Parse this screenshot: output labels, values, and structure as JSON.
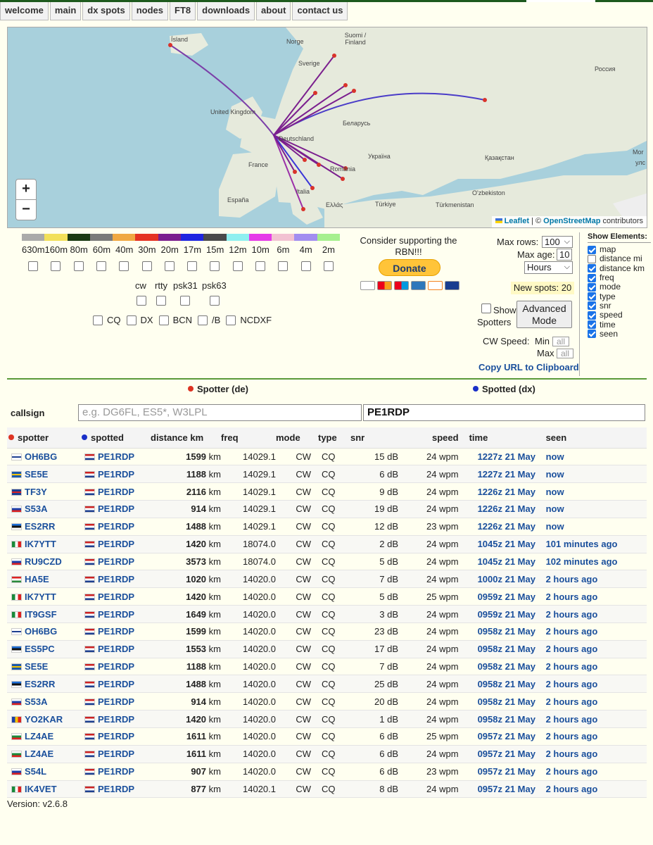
{
  "nav": [
    "welcome",
    "main",
    "dx spots",
    "nodes",
    "FT8",
    "downloads",
    "about",
    "contact us"
  ],
  "map": {
    "labels": [
      "Ísland",
      "Suomi / Finland",
      "Norge",
      "Sverige",
      "Россия",
      "United Kingdom",
      "Беларусь",
      "Deutschland",
      "France",
      "Україна",
      "Қазақстан",
      "România",
      "España",
      "Italia",
      "Ελλάς",
      "Türkiye",
      "O'zbekiston",
      "Türkmenistan",
      "Mor",
      "улс"
    ],
    "zoom_in": "+",
    "zoom_out": "−",
    "attribution_leaflet": "Leaflet",
    "attribution_sep": " | © ",
    "attribution_osm": "OpenStreetMap",
    "attribution_tail": " contributors"
  },
  "bands": {
    "labels": [
      "630m",
      "160m",
      "80m",
      "60m",
      "40m",
      "30m",
      "20m",
      "17m",
      "15m",
      "12m",
      "10m",
      "6m",
      "4m",
      "2m"
    ],
    "colors": [
      "#aaaaaa",
      "#f2e05a",
      "#1b3a12",
      "#7a7a7a",
      "#f0a842",
      "#e53322",
      "#7b1f8e",
      "#1f26e0",
      "#4a4a4a",
      "#8ff0f0",
      "#e63be8",
      "#f2c2d2",
      "#a28ef0",
      "#a6f08e"
    ]
  },
  "modes": [
    "cw",
    "rtty",
    "psk31",
    "psk63"
  ],
  "filters": [
    "CQ",
    "DX",
    "BCN",
    "/B",
    "NCDXF"
  ],
  "donate": {
    "message": "Consider supporting the RBN!!!",
    "button": "Donate"
  },
  "controls": {
    "max_rows_label": "Max rows:",
    "max_rows_value": "100",
    "max_age_label": "Max age:",
    "max_age_value": "10",
    "age_unit": "Hours",
    "new_spots": "New spots: 20",
    "show_label": "Show",
    "spotters_label": "Spotters",
    "advanced_mode": "Advanced Mode",
    "cw_speed_label": "CW Speed:",
    "min_label": "Min",
    "max_label": "Max",
    "all_placeholder": "all",
    "copy_url": "Copy URL to Clipboard"
  },
  "show_elements": {
    "title": "Show Elements:",
    "items": [
      {
        "label": "map",
        "checked": true
      },
      {
        "label": "distance mi",
        "checked": false
      },
      {
        "label": "distance km",
        "checked": true
      },
      {
        "label": "freq",
        "checked": true
      },
      {
        "label": "mode",
        "checked": true
      },
      {
        "label": "type",
        "checked": true
      },
      {
        "label": "snr",
        "checked": true
      },
      {
        "label": "speed",
        "checked": true
      },
      {
        "label": "time",
        "checked": true
      },
      {
        "label": "seen",
        "checked": true
      }
    ]
  },
  "search": {
    "spotter_header": "Spotter (de)",
    "spotted_header": "Spotted (dx)",
    "callsign_label": "callsign",
    "spotter_placeholder": "e.g. DG6FL, ES5*, W3LPL",
    "spotted_value": "PE1RDP"
  },
  "table": {
    "headers": [
      "spotter",
      "spotted",
      "distance km",
      "freq",
      "mode",
      "type",
      "snr",
      "speed",
      "time",
      "seen"
    ],
    "rows": [
      {
        "spotter": "OH6BG",
        "flag": "fi",
        "spotted": "PE1RDP",
        "dist": "1599",
        "unit": "km",
        "freq": "14029.1",
        "mode": "CW",
        "type": "CQ",
        "snr": "15 dB",
        "speed": "24 wpm",
        "time": "1227z 21 May",
        "seen": "now"
      },
      {
        "spotter": "SE5E",
        "flag": "se",
        "spotted": "PE1RDP",
        "dist": "1188",
        "unit": "km",
        "freq": "14029.1",
        "mode": "CW",
        "type": "CQ",
        "snr": "6 dB",
        "speed": "24 wpm",
        "time": "1227z 21 May",
        "seen": "now"
      },
      {
        "spotter": "TF3Y",
        "flag": "is",
        "spotted": "PE1RDP",
        "dist": "2116",
        "unit": "km",
        "freq": "14029.1",
        "mode": "CW",
        "type": "CQ",
        "snr": "9 dB",
        "speed": "24 wpm",
        "time": "1226z 21 May",
        "seen": "now"
      },
      {
        "spotter": "S53A",
        "flag": "si",
        "spotted": "PE1RDP",
        "dist": "914",
        "unit": "km",
        "freq": "14029.1",
        "mode": "CW",
        "type": "CQ",
        "snr": "19 dB",
        "speed": "24 wpm",
        "time": "1226z 21 May",
        "seen": "now"
      },
      {
        "spotter": "ES2RR",
        "flag": "ee",
        "spotted": "PE1RDP",
        "dist": "1488",
        "unit": "km",
        "freq": "14029.1",
        "mode": "CW",
        "type": "CQ",
        "snr": "12 dB",
        "speed": "23 wpm",
        "time": "1226z 21 May",
        "seen": "now"
      },
      {
        "spotter": "IK7YTT",
        "flag": "it",
        "spotted": "PE1RDP",
        "dist": "1420",
        "unit": "km",
        "freq": "18074.0",
        "mode": "CW",
        "type": "CQ",
        "snr": "2 dB",
        "speed": "24 wpm",
        "time": "1045z 21 May",
        "seen": "101 minutes ago"
      },
      {
        "spotter": "RU9CZD",
        "flag": "ru",
        "spotted": "PE1RDP",
        "dist": "3573",
        "unit": "km",
        "freq": "18074.0",
        "mode": "CW",
        "type": "CQ",
        "snr": "5 dB",
        "speed": "24 wpm",
        "time": "1045z 21 May",
        "seen": "102 minutes ago"
      },
      {
        "spotter": "HA5E",
        "flag": "hu",
        "spotted": "PE1RDP",
        "dist": "1020",
        "unit": "km",
        "freq": "14020.0",
        "mode": "CW",
        "type": "CQ",
        "snr": "7 dB",
        "speed": "24 wpm",
        "time": "1000z 21 May",
        "seen": "2 hours ago"
      },
      {
        "spotter": "IK7YTT",
        "flag": "it",
        "spotted": "PE1RDP",
        "dist": "1420",
        "unit": "km",
        "freq": "14020.0",
        "mode": "CW",
        "type": "CQ",
        "snr": "5 dB",
        "speed": "25 wpm",
        "time": "0959z 21 May",
        "seen": "2 hours ago"
      },
      {
        "spotter": "IT9GSF",
        "flag": "it",
        "spotted": "PE1RDP",
        "dist": "1649",
        "unit": "km",
        "freq": "14020.0",
        "mode": "CW",
        "type": "CQ",
        "snr": "3 dB",
        "speed": "24 wpm",
        "time": "0959z 21 May",
        "seen": "2 hours ago"
      },
      {
        "spotter": "OH6BG",
        "flag": "fi",
        "spotted": "PE1RDP",
        "dist": "1599",
        "unit": "km",
        "freq": "14020.0",
        "mode": "CW",
        "type": "CQ",
        "snr": "23 dB",
        "speed": "24 wpm",
        "time": "0958z 21 May",
        "seen": "2 hours ago"
      },
      {
        "spotter": "ES5PC",
        "flag": "ee",
        "spotted": "PE1RDP",
        "dist": "1553",
        "unit": "km",
        "freq": "14020.0",
        "mode": "CW",
        "type": "CQ",
        "snr": "17 dB",
        "speed": "24 wpm",
        "time": "0958z 21 May",
        "seen": "2 hours ago"
      },
      {
        "spotter": "SE5E",
        "flag": "se",
        "spotted": "PE1RDP",
        "dist": "1188",
        "unit": "km",
        "freq": "14020.0",
        "mode": "CW",
        "type": "CQ",
        "snr": "7 dB",
        "speed": "24 wpm",
        "time": "0958z 21 May",
        "seen": "2 hours ago"
      },
      {
        "spotter": "ES2RR",
        "flag": "ee",
        "spotted": "PE1RDP",
        "dist": "1488",
        "unit": "km",
        "freq": "14020.0",
        "mode": "CW",
        "type": "CQ",
        "snr": "25 dB",
        "speed": "24 wpm",
        "time": "0958z 21 May",
        "seen": "2 hours ago"
      },
      {
        "spotter": "S53A",
        "flag": "si",
        "spotted": "PE1RDP",
        "dist": "914",
        "unit": "km",
        "freq": "14020.0",
        "mode": "CW",
        "type": "CQ",
        "snr": "20 dB",
        "speed": "24 wpm",
        "time": "0958z 21 May",
        "seen": "2 hours ago"
      },
      {
        "spotter": "YO2KAR",
        "flag": "ro",
        "spotted": "PE1RDP",
        "dist": "1420",
        "unit": "km",
        "freq": "14020.0",
        "mode": "CW",
        "type": "CQ",
        "snr": "1 dB",
        "speed": "24 wpm",
        "time": "0958z 21 May",
        "seen": "2 hours ago"
      },
      {
        "spotter": "LZ4AE",
        "flag": "bg",
        "spotted": "PE1RDP",
        "dist": "1611",
        "unit": "km",
        "freq": "14020.0",
        "mode": "CW",
        "type": "CQ",
        "snr": "6 dB",
        "speed": "25 wpm",
        "time": "0957z 21 May",
        "seen": "2 hours ago"
      },
      {
        "spotter": "LZ4AE",
        "flag": "bg",
        "spotted": "PE1RDP",
        "dist": "1611",
        "unit": "km",
        "freq": "14020.0",
        "mode": "CW",
        "type": "CQ",
        "snr": "6 dB",
        "speed": "24 wpm",
        "time": "0957z 21 May",
        "seen": "2 hours ago"
      },
      {
        "spotter": "S54L",
        "flag": "si",
        "spotted": "PE1RDP",
        "dist": "907",
        "unit": "km",
        "freq": "14020.0",
        "mode": "CW",
        "type": "CQ",
        "snr": "6 dB",
        "speed": "23 wpm",
        "time": "0957z 21 May",
        "seen": "2 hours ago"
      },
      {
        "spotter": "IK4VET",
        "flag": "it",
        "spotted": "PE1RDP",
        "dist": "877",
        "unit": "km",
        "freq": "14020.1",
        "mode": "CW",
        "type": "CQ",
        "snr": "8 dB",
        "speed": "24 wpm",
        "time": "0957z 21 May",
        "seen": "2 hours ago"
      }
    ]
  },
  "version": "Version: v2.6.8"
}
